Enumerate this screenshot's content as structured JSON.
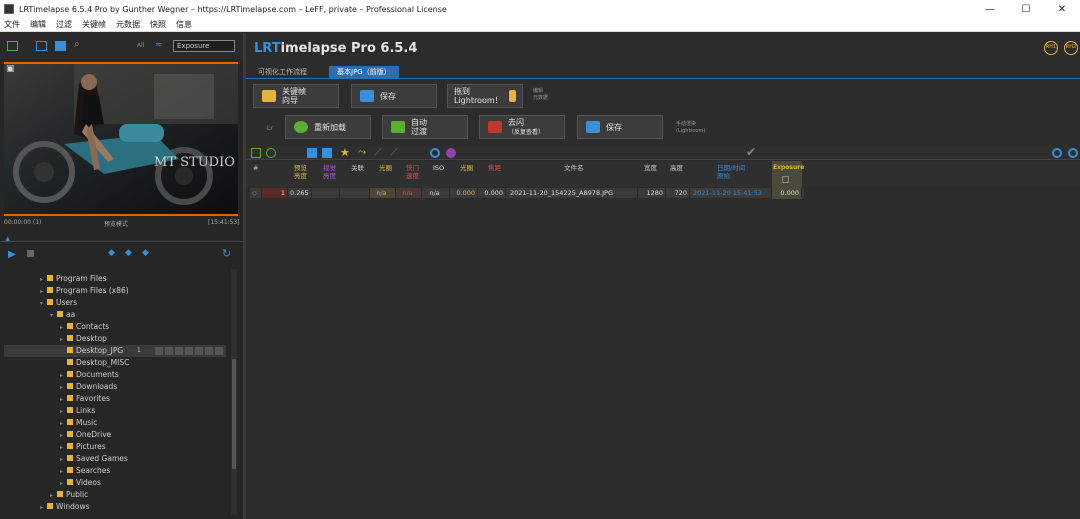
{
  "window": {
    "title": "LRTimelapse 6.5.4 Pro by Gunther Wegner – https://LRTimelapse.com – LeFF, private – Professional License",
    "minimize": "—",
    "maximize": "☐",
    "close": "✕"
  },
  "menu": [
    "文件",
    "编辑",
    "过滤",
    "关键帧",
    "元数据",
    "快照",
    "信息"
  ],
  "left": {
    "toolbar": {
      "label_all": "All",
      "field_value": "Exposure"
    },
    "preview": {
      "watermark": "MT STUDIO",
      "time_start": "00:00:00 (1)",
      "mode": "预览模式",
      "time_end": "[15:41:53]"
    },
    "tree": [
      {
        "label": "Program Files",
        "indent": 1,
        "expander": "▸"
      },
      {
        "label": "Program Files (x86)",
        "indent": 1,
        "expander": "▸"
      },
      {
        "label": "Users",
        "indent": 1,
        "expander": "▾"
      },
      {
        "label": "aa",
        "indent": 2,
        "expander": "▾"
      },
      {
        "label": "Contacts",
        "indent": 3,
        "expander": "▸"
      },
      {
        "label": "Desktop",
        "indent": 3,
        "expander": "▸"
      },
      {
        "label": "Desktop_JPG",
        "indent": 3,
        "expander": "",
        "selected": true,
        "count": "1"
      },
      {
        "label": "Desktop_MISC",
        "indent": 3,
        "expander": ""
      },
      {
        "label": "Documents",
        "indent": 3,
        "expander": "▸"
      },
      {
        "label": "Downloads",
        "indent": 3,
        "expander": "▸"
      },
      {
        "label": "Favorites",
        "indent": 3,
        "expander": "▸"
      },
      {
        "label": "Links",
        "indent": 3,
        "expander": "▸"
      },
      {
        "label": "Music",
        "indent": 3,
        "expander": "▸"
      },
      {
        "label": "OneDrive",
        "indent": 3,
        "expander": "▸"
      },
      {
        "label": "Pictures",
        "indent": 3,
        "expander": "▸"
      },
      {
        "label": "Saved Games",
        "indent": 3,
        "expander": "▸"
      },
      {
        "label": "Searches",
        "indent": 3,
        "expander": "▸"
      },
      {
        "label": "Videos",
        "indent": 3,
        "expander": "▸"
      },
      {
        "label": "Public",
        "indent": 2,
        "expander": "▸"
      },
      {
        "label": "Windows",
        "indent": 1,
        "expander": "▸"
      }
    ]
  },
  "right": {
    "brand_lr": "LRT",
    "brand_rest": "imelapse Pro 6.5.4",
    "icon_left": "RH1",
    "icon_right": "RH2",
    "tabs": [
      "可视化工作流程",
      "基本JPG（前版）"
    ],
    "row1": {
      "keyframe_wizard": [
        "关键帧",
        "向导"
      ],
      "save": "保存",
      "drag_lightroom": [
        "拖到",
        "Lightroom！"
      ],
      "hint": [
        "编辑",
        "元数据"
      ]
    },
    "row2": {
      "lr": "Lr",
      "reload": "重新加载",
      "auto_transition": [
        "自动",
        "过渡"
      ],
      "deflicker": [
        "去闪",
        "（反复查看）"
      ],
      "save": "保存",
      "hint": [
        "手动渲染",
        "(Lightroom)"
      ]
    },
    "columns": {
      "index": "#",
      "pre_exposure": [
        "预览",
        "亮度"
      ],
      "smooth_exposure": [
        "视觉",
        "亮度"
      ],
      "dates": "关联",
      "exposure_keyframe": "光圈",
      "shutter": [
        "快门",
        "速度"
      ],
      "iso": "ISO",
      "aperture": "光圈",
      "focal": "焦距",
      "filename": "文件名",
      "width": "宽度",
      "height": "高度",
      "datetime": [
        "日期/时间",
        "原始"
      ],
      "exposure": "Exposure"
    },
    "row_values": {
      "index": "1",
      "preview_lum": "0.265",
      "aperture_f": "n/a",
      "shutter": "n/a",
      "iso": "n/a",
      "v1": "0.000",
      "v2": "0.000",
      "filename": "2021-11-20_154225_A8978.JPG",
      "width": "1280",
      "height": "720",
      "datetime": "2021-11-20 15:41:53",
      "exposure": "0.000"
    }
  }
}
